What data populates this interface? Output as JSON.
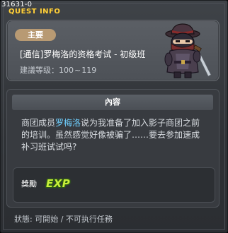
{
  "window": {
    "quest_id": "31631-0",
    "title": "QUEST INFO"
  },
  "header": {
    "badge": "主要",
    "quest_title": "[通信]罗梅洛的资格考试 - 初级班",
    "level_label": "建議等级：",
    "level_min": "100",
    "level_sep": "~",
    "level_max": "119"
  },
  "content": {
    "section_title": "內容",
    "description_prefix": "商团成员",
    "npc_name": "罗梅洛",
    "description_suffix": "说为我准备了加入影子商团之前的培训。虽然感觉好像被骗了……要去参加速成补习班试试吗?",
    "reward_label": "獎勵",
    "reward_exp": "EXP"
  },
  "footer": {
    "status": "狀態: 可開始 / 不可执行任務"
  },
  "colors": {
    "title_accent": "#ffd23f",
    "badge_bg": "#b89a73",
    "npc_highlight": "#6fd0ff",
    "exp_green": "#c9f03a"
  }
}
